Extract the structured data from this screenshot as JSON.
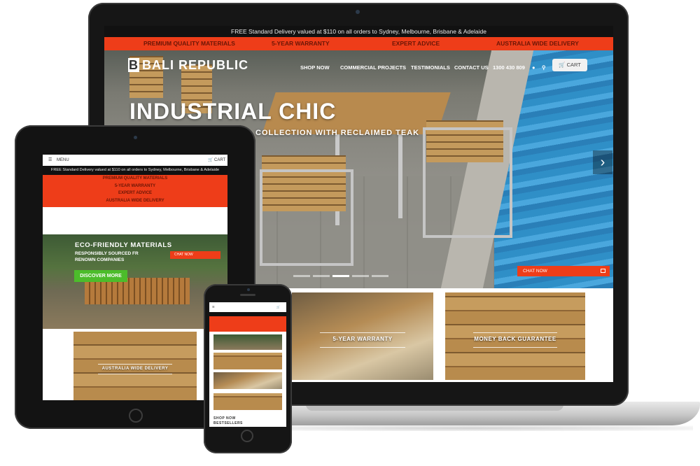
{
  "laptop": {
    "topbar": "FREE Standard Delivery valued at $110 on all orders to Sydney, Melbourne, Brisbane & Adelaide",
    "usps": [
      "PREMIUM QUALITY MATERIALS",
      "5-YEAR WARRANTY",
      "EXPERT ADVICE",
      "AUSTRALIA WIDE DELIVERY"
    ],
    "logo": {
      "mark": "B",
      "text": "BALI REPUBLIC"
    },
    "nav": [
      "SHOP NOW",
      "COMMERCIAL PROJECTS",
      "TESTIMONIALS",
      "CONTACT US",
      "1300 430 809"
    ],
    "cart": "CART",
    "hero_title": "INDUSTRIAL CHIC",
    "hero_subtitle": "COLLECTION WITH RECLAIMED TEAK",
    "next_arrow": "›",
    "chat": "CHAT NOW",
    "tiles": [
      "5-YEAR WARRANTY",
      "MONEY BACK GUARANTEE"
    ]
  },
  "tablet": {
    "menu": "MENU",
    "cart": "CART",
    "topbar": "FREE Standard Delivery valued at $110 on all orders to Sydney, Melbourne, Brisbane & Adelaide",
    "usps": [
      "PREMIUM QUALITY MATERIALS",
      "5-YEAR WARRANTY",
      "EXPERT ADVICE",
      "AUSTRALIA WIDE DELIVERY"
    ],
    "hero_title": "ECO-FRIENDLY MATERIALS",
    "hero_subtitle_1": "RESPONSIBLY SOURCED FR",
    "hero_subtitle_2": "RENOWN COMPANIES",
    "chat": "CHAT NOW",
    "cta": "DISCOVER MORE",
    "tile": "AUSTRALIA WIDE DELIVERY"
  },
  "phone": {
    "shop": "SHOP NOW",
    "bestsellers": "BESTSELLERS"
  },
  "colors": {
    "accent": "#ee3d19",
    "cta_green": "#4cbc2b",
    "topbar": "#111111"
  }
}
